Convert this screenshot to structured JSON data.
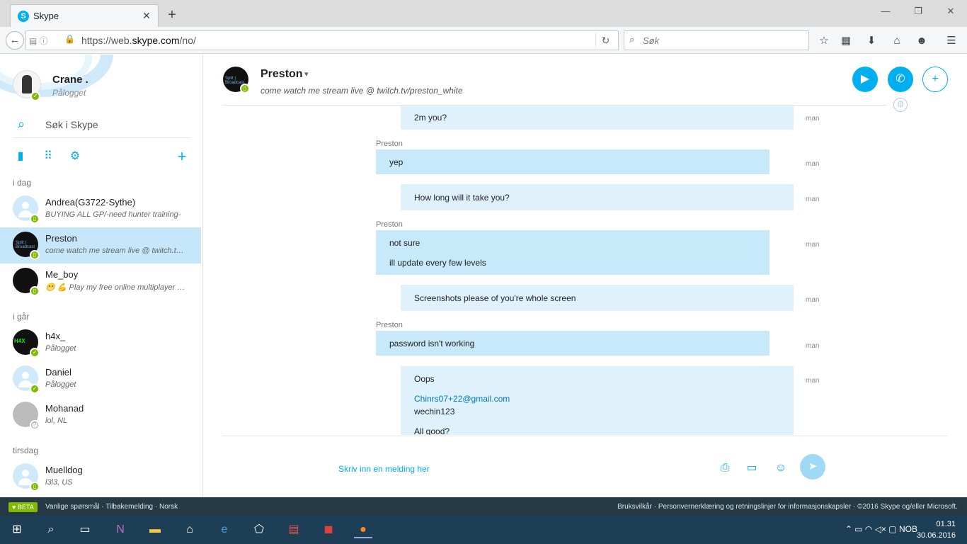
{
  "browser": {
    "tab_title": "Skype",
    "url_prefix": "https://web.",
    "url_domain": "skype.com",
    "url_path": "/no/",
    "search_placeholder": "Søk"
  },
  "profile": {
    "name": "Crane .",
    "status": "Pålogget",
    "search_placeholder": "Søk i Skype"
  },
  "sections": {
    "today": "i dag",
    "yesterday": "i går",
    "tuesday": "tirsdag"
  },
  "contacts": [
    {
      "name": "Andrea(G3722-Sythe)",
      "status": "BUYING ALL GP/-need hunter training-"
    },
    {
      "name": "Preston",
      "status": "come watch me stream live @ twitch.tv/preston_white"
    },
    {
      "name": "Me_boy",
      "status": "Play my free online multiplayer game"
    },
    {
      "name": "h4x_",
      "status": "Pålogget"
    },
    {
      "name": "Daniel",
      "status": "Pålogget"
    },
    {
      "name": "Mohanad",
      "status": "lol, NL"
    },
    {
      "name": "Muelldog",
      "status": "l3l3, US"
    }
  ],
  "avatar_text": {
    "preston": "Split | Broadcast",
    "h4x": "H4X"
  },
  "conversation": {
    "name": "Preston",
    "mood": "come watch me stream live @ twitch.tv/preston_white",
    "composer_placeholder": "Skriv inn en melding her",
    "time_label": "man",
    "messages": [
      {
        "sender": "",
        "lines": [
          "2m you?"
        ]
      },
      {
        "sender": "Preston",
        "lines": [
          "yep"
        ]
      },
      {
        "sender": "",
        "lines": [
          "How long will it take you?"
        ]
      },
      {
        "sender": "Preston",
        "lines": [
          "not sure",
          "ill update every few levels"
        ]
      },
      {
        "sender": "",
        "lines": [
          "Screenshots please of you're whole screen"
        ]
      },
      {
        "sender": "Preston",
        "lines": [
          "password isn't working"
        ]
      },
      {
        "sender": "",
        "lines": [
          "Oops",
          "Chinrs07+22@gmail.com",
          "wechin123",
          "All good?"
        ]
      }
    ]
  },
  "footer": {
    "beta": "BETA",
    "faq": "Vanlige spørsmål",
    "feedback": "Tilbakemelding",
    "language": "Norsk",
    "terms": "Bruksvilkår",
    "privacy": "Personvernerklæring og retningslinjer for informasjonskapsler",
    "copyright": "©2016 Skype og/eller Microsoft."
  },
  "taskbar": {
    "lang": "NOB",
    "time": "01.31",
    "date": "30.06.2016"
  },
  "colors": {
    "skype_blue": "#00aff0",
    "presence_online": "#7fba00",
    "bubble_theirs": "#c7e9fa",
    "bubble_mine": "#dff2fc",
    "footer_bg": "#253a44",
    "taskbar_bg": "#1e3e55"
  }
}
